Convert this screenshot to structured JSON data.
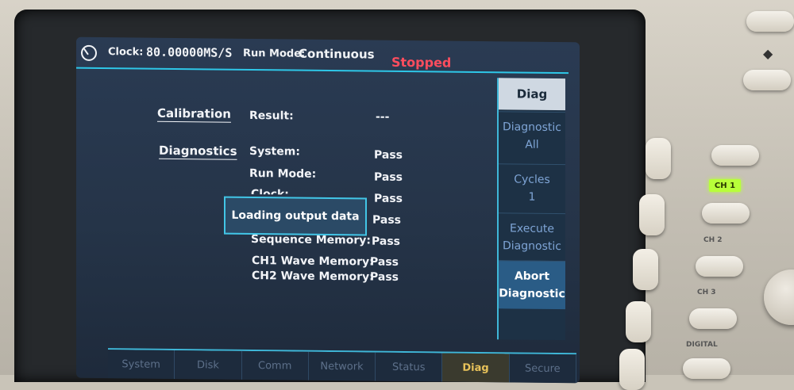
{
  "status_bar": {
    "clock_label": "Clock:",
    "clock_value": "80.00000MS/S",
    "run_mode_label": "Run Mode:",
    "run_mode_value": "Continuous",
    "state": "Stopped",
    "state_color": "#ff4d5e"
  },
  "nav": {
    "calibration": "Calibration",
    "diagnostics": "Diagnostics"
  },
  "calibration": {
    "result_label": "Result:",
    "result_value": "---"
  },
  "diagnostics": {
    "rows": [
      {
        "label": "System:",
        "value": "Pass"
      },
      {
        "label": "Run Mode:",
        "value": "Pass"
      },
      {
        "label": "Clock:",
        "value": "Pass"
      },
      {
        "label": "",
        "value": "Pass"
      },
      {
        "label": "Sequence Memory:",
        "value": "Pass"
      },
      {
        "label": "CH1 Wave Memory:",
        "value": "Pass"
      },
      {
        "label": "CH2 Wave Memory:",
        "value": "Pass"
      }
    ]
  },
  "dialog": {
    "message": "Loading output data"
  },
  "side_menu": {
    "title": "Diag",
    "items": [
      {
        "line1": "Diagnostic",
        "line2": "All"
      },
      {
        "line1": "Cycles",
        "line2": "1"
      },
      {
        "line1": "Execute",
        "line2": "Diagnostic"
      },
      {
        "line1": "Abort",
        "line2": "Diagnostic"
      }
    ]
  },
  "tabs": [
    {
      "label": "System"
    },
    {
      "label": "Disk"
    },
    {
      "label": "Comm"
    },
    {
      "label": "Network"
    },
    {
      "label": "Status"
    },
    {
      "label": "Diag"
    },
    {
      "label": "Secure"
    }
  ],
  "bezel": {
    "ch1_label": "CH 1",
    "ch2_label": "CH 2",
    "ch3_label": "CH 3",
    "digital_label": "DIGITAL",
    "ch1_badge_color": "#b8ff3a"
  },
  "colors": {
    "accent": "#2ec7e8",
    "screen_bg": "#253448",
    "active_tab_text": "#e8c25a"
  }
}
